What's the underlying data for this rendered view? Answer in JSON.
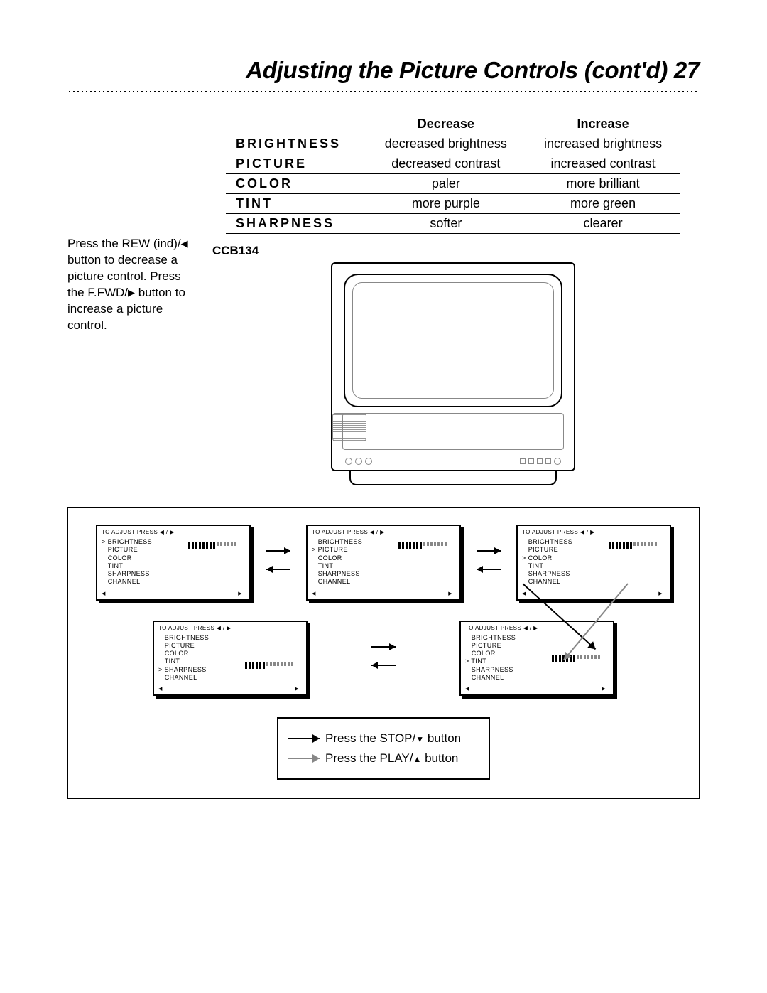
{
  "page": {
    "title_text": "Adjusting the Picture Controls (cont'd)",
    "page_number": "27"
  },
  "table": {
    "head_blank": "",
    "head_dec": "Decrease",
    "head_inc": "Increase",
    "rows": [
      {
        "label": "BRIGHTNESS",
        "dec": "decreased brightness",
        "inc": "increased brightness"
      },
      {
        "label": "PICTURE",
        "dec": "decreased contrast",
        "inc": "increased contrast"
      },
      {
        "label": "COLOR",
        "dec": "paler",
        "inc": "more brilliant"
      },
      {
        "label": "TINT",
        "dec": "more purple",
        "inc": "more green"
      },
      {
        "label": "SHARPNESS",
        "dec": "softer",
        "inc": "clearer"
      }
    ]
  },
  "side_note": {
    "line1a": "Press the REW (ind)/",
    "line1b": " button to decrease a picture control. Press the F.FWD/",
    "line1c": " button to increase a picture control."
  },
  "model_label": "CCB134",
  "osd": {
    "head_prefix": "TO ADJUST PRESS ",
    "items": [
      "BRIGHTNESS",
      "PICTURE",
      "COLOR",
      "TINT",
      "SHARPNESS",
      "CHANNEL"
    ]
  },
  "osd_panels": [
    {
      "selected": "BRIGHTNESS",
      "bar_pos": "right"
    },
    {
      "selected": "PICTURE",
      "bar_pos": "right"
    },
    {
      "selected": "COLOR",
      "bar_pos": "right"
    },
    {
      "selected": "SHARPNESS",
      "bar_pos": "right"
    },
    {
      "selected": "TINT",
      "bar_pos": "right"
    }
  ],
  "legend": {
    "stop_a": "Press the STOP/",
    "stop_b": " button",
    "play_a": "Press the PLAY/",
    "play_b": " button"
  },
  "icons": {
    "tri_left": "◀",
    "tri_right": "▶",
    "tri_down": "▼",
    "tri_up": "▲"
  }
}
